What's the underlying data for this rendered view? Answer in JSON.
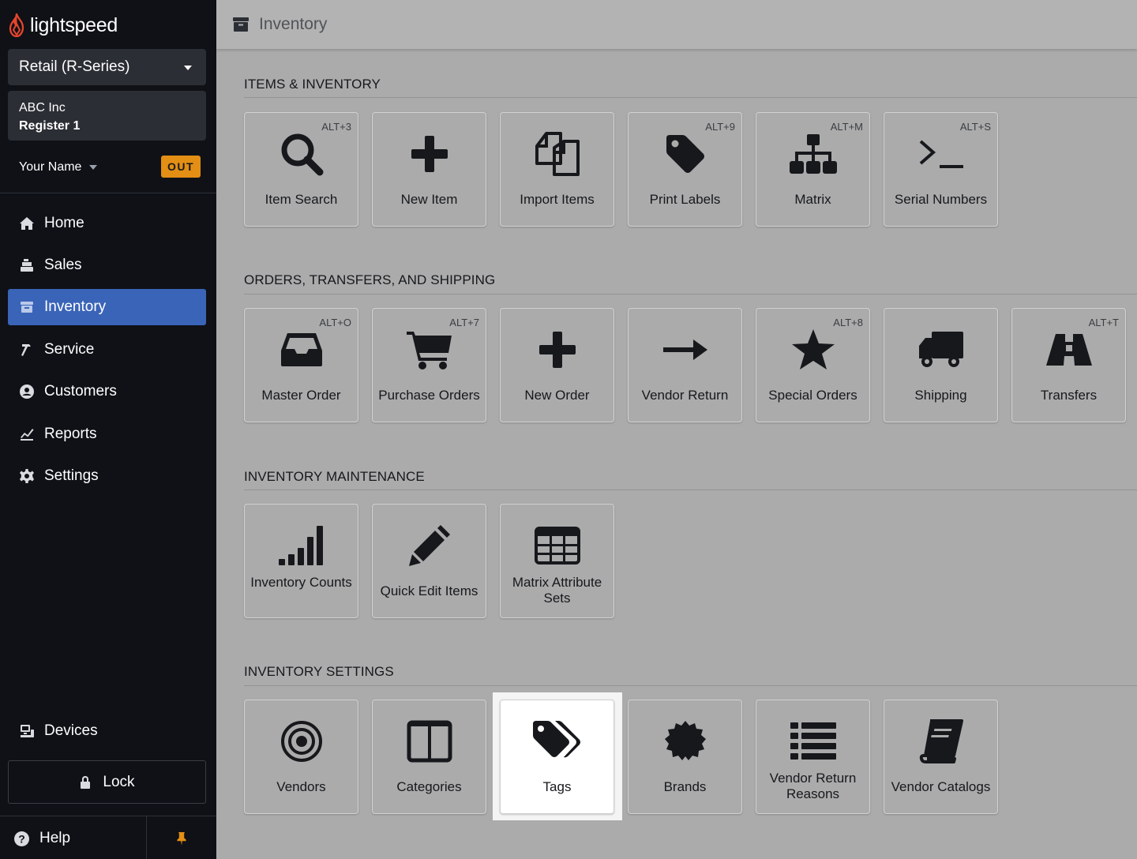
{
  "brand": {
    "name": "lightspeed"
  },
  "sidebar": {
    "store": "Retail (R-Series)",
    "company": "ABC Inc",
    "register": "Register 1",
    "user_name": "Your Name",
    "clock_status": "OUT",
    "nav": [
      {
        "label": "Home",
        "icon": "home-icon"
      },
      {
        "label": "Sales",
        "icon": "register-icon"
      },
      {
        "label": "Inventory",
        "icon": "inventory-icon",
        "active": true
      },
      {
        "label": "Service",
        "icon": "hammer-icon"
      },
      {
        "label": "Customers",
        "icon": "customer-icon"
      },
      {
        "label": "Reports",
        "icon": "reports-icon"
      },
      {
        "label": "Settings",
        "icon": "gear-icon"
      }
    ],
    "devices": "Devices",
    "lock": "Lock",
    "help": "Help"
  },
  "header": {
    "title": "Inventory"
  },
  "sections": [
    {
      "title": "ITEMS & INVENTORY",
      "tiles": [
        {
          "label": "Item Search",
          "shortcut": "ALT+3",
          "icon": "search-icon"
        },
        {
          "label": "New Item",
          "shortcut": "",
          "icon": "plus-icon"
        },
        {
          "label": "Import Items",
          "shortcut": "",
          "icon": "copy-icon"
        },
        {
          "label": "Print Labels",
          "shortcut": "ALT+9",
          "icon": "tag-icon"
        },
        {
          "label": "Matrix",
          "shortcut": "ALT+M",
          "icon": "sitemap-icon"
        },
        {
          "label": "Serial Numbers",
          "shortcut": "ALT+S",
          "icon": "terminal-icon"
        }
      ]
    },
    {
      "title": "ORDERS, TRANSFERS, AND SHIPPING",
      "tiles": [
        {
          "label": "Master Order",
          "shortcut": "ALT+O",
          "icon": "inbox-icon"
        },
        {
          "label": "Purchase Orders",
          "shortcut": "ALT+7",
          "icon": "cart-icon"
        },
        {
          "label": "New Order",
          "shortcut": "",
          "icon": "plus-icon"
        },
        {
          "label": "Vendor Return",
          "shortcut": "",
          "icon": "arrow-right-icon"
        },
        {
          "label": "Special Orders",
          "shortcut": "ALT+8",
          "icon": "star-icon"
        },
        {
          "label": "Shipping",
          "shortcut": "",
          "icon": "truck-icon"
        },
        {
          "label": "Transfers",
          "shortcut": "ALT+T",
          "icon": "road-icon"
        }
      ]
    },
    {
      "title": "INVENTORY MAINTENANCE",
      "tiles": [
        {
          "label": "Inventory Counts",
          "shortcut": "",
          "icon": "signal-icon"
        },
        {
          "label": "Quick Edit Items",
          "shortcut": "",
          "icon": "pencil-icon"
        },
        {
          "label": "Matrix Attribute Sets",
          "shortcut": "",
          "icon": "table-icon"
        }
      ]
    },
    {
      "title": "INVENTORY SETTINGS",
      "tiles": [
        {
          "label": "Vendors",
          "shortcut": "",
          "icon": "bullseye-icon"
        },
        {
          "label": "Categories",
          "shortcut": "",
          "icon": "columns-icon"
        },
        {
          "label": "Tags",
          "shortcut": "",
          "icon": "tags-icon",
          "highlighted": true
        },
        {
          "label": "Brands",
          "shortcut": "",
          "icon": "certificate-icon"
        },
        {
          "label": "Vendor Return Reasons",
          "shortcut": "",
          "icon": "list-icon"
        },
        {
          "label": "Vendor Catalogs",
          "shortcut": "",
          "icon": "book-icon"
        }
      ]
    }
  ],
  "colors": {
    "sidebar_bg": "#0f1117",
    "active_nav": "#3a64b8",
    "out_badge": "#e38e14",
    "content_bg": "#ababab"
  }
}
